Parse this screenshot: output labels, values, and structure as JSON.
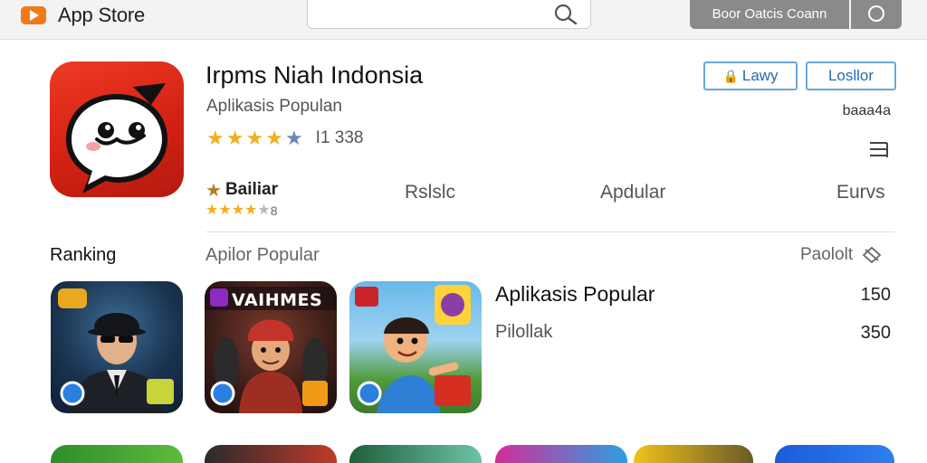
{
  "topbar": {
    "brand_name": "App Store",
    "search_placeholder": "",
    "primary_button_label": "Boor Oatcis Coann"
  },
  "app": {
    "title": "Irpms Niah Indonsia",
    "subtitle": "Aplikasis Populan",
    "rating_stars": 4.5,
    "rating_count": "I1 338",
    "buttons": {
      "first_label": "Lawy",
      "second_label": "Losllor"
    },
    "meta_right": "baaa4a"
  },
  "subtabs": {
    "featured_label": "Bailiar",
    "featured_rating": "8",
    "featured_stars": 3.5,
    "tab1": "Rslslc",
    "tab2": "Apdular",
    "tab3": "Eurvs"
  },
  "ranking": {
    "title": "Ranking",
    "subtitle": "Apilor Popular",
    "link_label": "Paololt",
    "tiles": [
      {
        "caption": ""
      },
      {
        "caption": "VAIHMES"
      },
      {
        "caption": ""
      }
    ],
    "list": [
      {
        "name": "Aplikasis Popular",
        "value": "150"
      },
      {
        "name": "Pilollak",
        "value": "350"
      }
    ]
  },
  "colors": {
    "accent_blue": "#2a69b0",
    "star_gold": "#f2b01e",
    "app_icon_red": "#d42114"
  }
}
